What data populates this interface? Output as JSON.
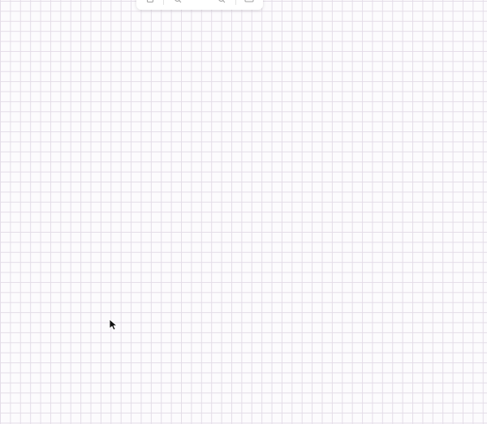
{
  "toolbar": {
    "zoom_level": "",
    "icons": [
      "undo-icon",
      "zoom-out-icon",
      "zoom-in-icon",
      "fit-view-icon"
    ]
  },
  "canvas": {
    "grid_color": "#e4dde8",
    "background_color": "#fcfbfd"
  },
  "cursor": {
    "icon": "pointer-cursor-icon"
  }
}
